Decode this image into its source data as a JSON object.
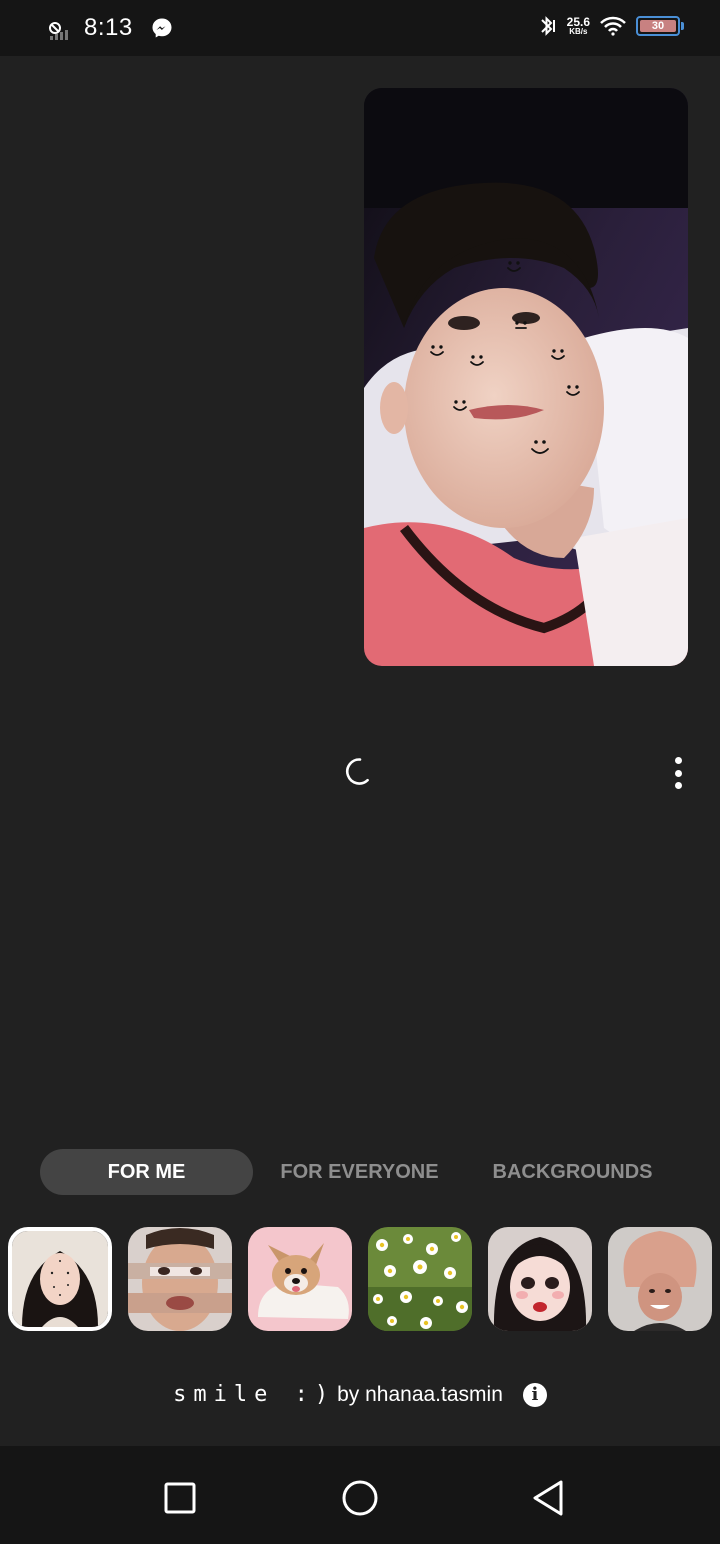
{
  "status_bar": {
    "time": "8:13",
    "net_speed_value": "25.6",
    "net_speed_unit": "KB/s",
    "battery_level": "30",
    "icons": [
      "dnd-icon",
      "signal-icon",
      "messenger-icon",
      "bluetooth-icon",
      "wifi-icon",
      "battery-icon"
    ]
  },
  "tabs": [
    {
      "label": "FOR ME",
      "active": true
    },
    {
      "label": "FOR EVERYONE",
      "active": false
    },
    {
      "label": "BACKGROUNDS",
      "active": false
    }
  ],
  "effects": [
    {
      "name": "smile-dots",
      "selected": true
    },
    {
      "name": "face-swap-stripes",
      "selected": false
    },
    {
      "name": "dog-sticker",
      "selected": false
    },
    {
      "name": "daisy-field",
      "selected": false
    },
    {
      "name": "doll-face",
      "selected": false
    },
    {
      "name": "big-forehead",
      "selected": false
    }
  ],
  "footer": {
    "effect_name": "smile :)",
    "by_text": " by nhanaa.tasmin"
  },
  "nav": [
    "recents-button",
    "home-button",
    "back-button"
  ],
  "colors": {
    "background": "#212121",
    "tab_active_bg": "#444444",
    "tab_inactive_text": "#8e8e8e",
    "battery_frame": "#4a8fd6"
  }
}
